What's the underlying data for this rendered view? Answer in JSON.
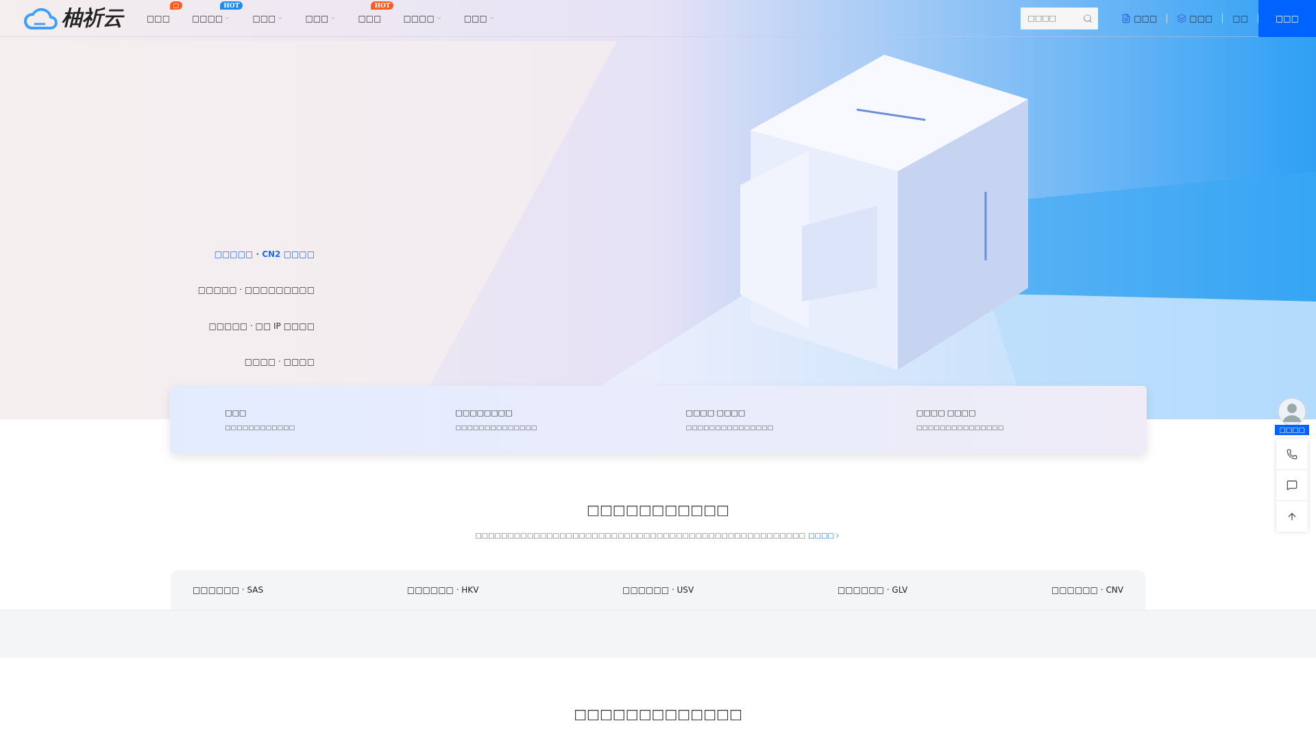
{
  "header": {
    "logo": "柚祈云",
    "nav": [
      {
        "label": "□□□",
        "badge": {
          "text": "□",
          "kind": "new"
        },
        "dropdown": false
      },
      {
        "label": "□□□□",
        "badge": {
          "text": "HOT",
          "kind": "blue"
        },
        "dropdown": true
      },
      {
        "label": "□□□",
        "dropdown": true
      },
      {
        "label": "□□□",
        "dropdown": true
      },
      {
        "label": "□□□",
        "badge": {
          "text": "HOT",
          "kind": "orange"
        },
        "dropdown": false
      },
      {
        "label": "□□□□",
        "dropdown": true
      },
      {
        "label": "□□□",
        "dropdown": true
      }
    ],
    "search": {
      "placeholder": "□□□□"
    },
    "links": [
      {
        "label": "□□□"
      },
      {
        "label": "□□□"
      },
      {
        "label": "□□"
      }
    ],
    "primary_button": "□□□"
  },
  "hero": {
    "menu": [
      {
        "label": "□□□□□ · CN2 □□□□",
        "selected": true
      },
      {
        "label": "□□□□□ · □□□□□□□□□",
        "selected": false
      },
      {
        "label": "□□□□□ · □□ IP □□□□",
        "selected": false
      },
      {
        "label": "□□□□ · □□□□",
        "selected": false
      }
    ]
  },
  "features": [
    {
      "title": "□□□",
      "desc": "□□□□□□□□□□□□"
    },
    {
      "title": "□□□□□□□□",
      "desc": "□□□□□□□□□□□□□□"
    },
    {
      "title": "□□□□ □□□□",
      "desc": "□□□□□□□□□□□□□□□"
    },
    {
      "title": "□□□□ □□□□",
      "desc": "□□□□□□□□□□□□□□□"
    }
  ],
  "section": {
    "title": "□□□□□□□□□□□",
    "subtitle": "□□□□□□□□□□□□□□□□□□□□□□□□□□□□□□□□□□□□□□□□□□□□□□□□□□□",
    "link": "□□□□"
  },
  "tabs": [
    {
      "label": "□□□□□□ · SAS",
      "selected": false
    },
    {
      "label": "□□□□□□ · HKV",
      "selected": false
    },
    {
      "label": "□□□□□□ · USV",
      "selected": false
    },
    {
      "label": "□□□□□□ · GLV",
      "selected": false
    },
    {
      "label": "□□□□□□ · CNV",
      "selected": false
    }
  ],
  "next_section": {
    "title": "□□□□□□□□□□□□□"
  },
  "float": {
    "label": "□□□□"
  }
}
